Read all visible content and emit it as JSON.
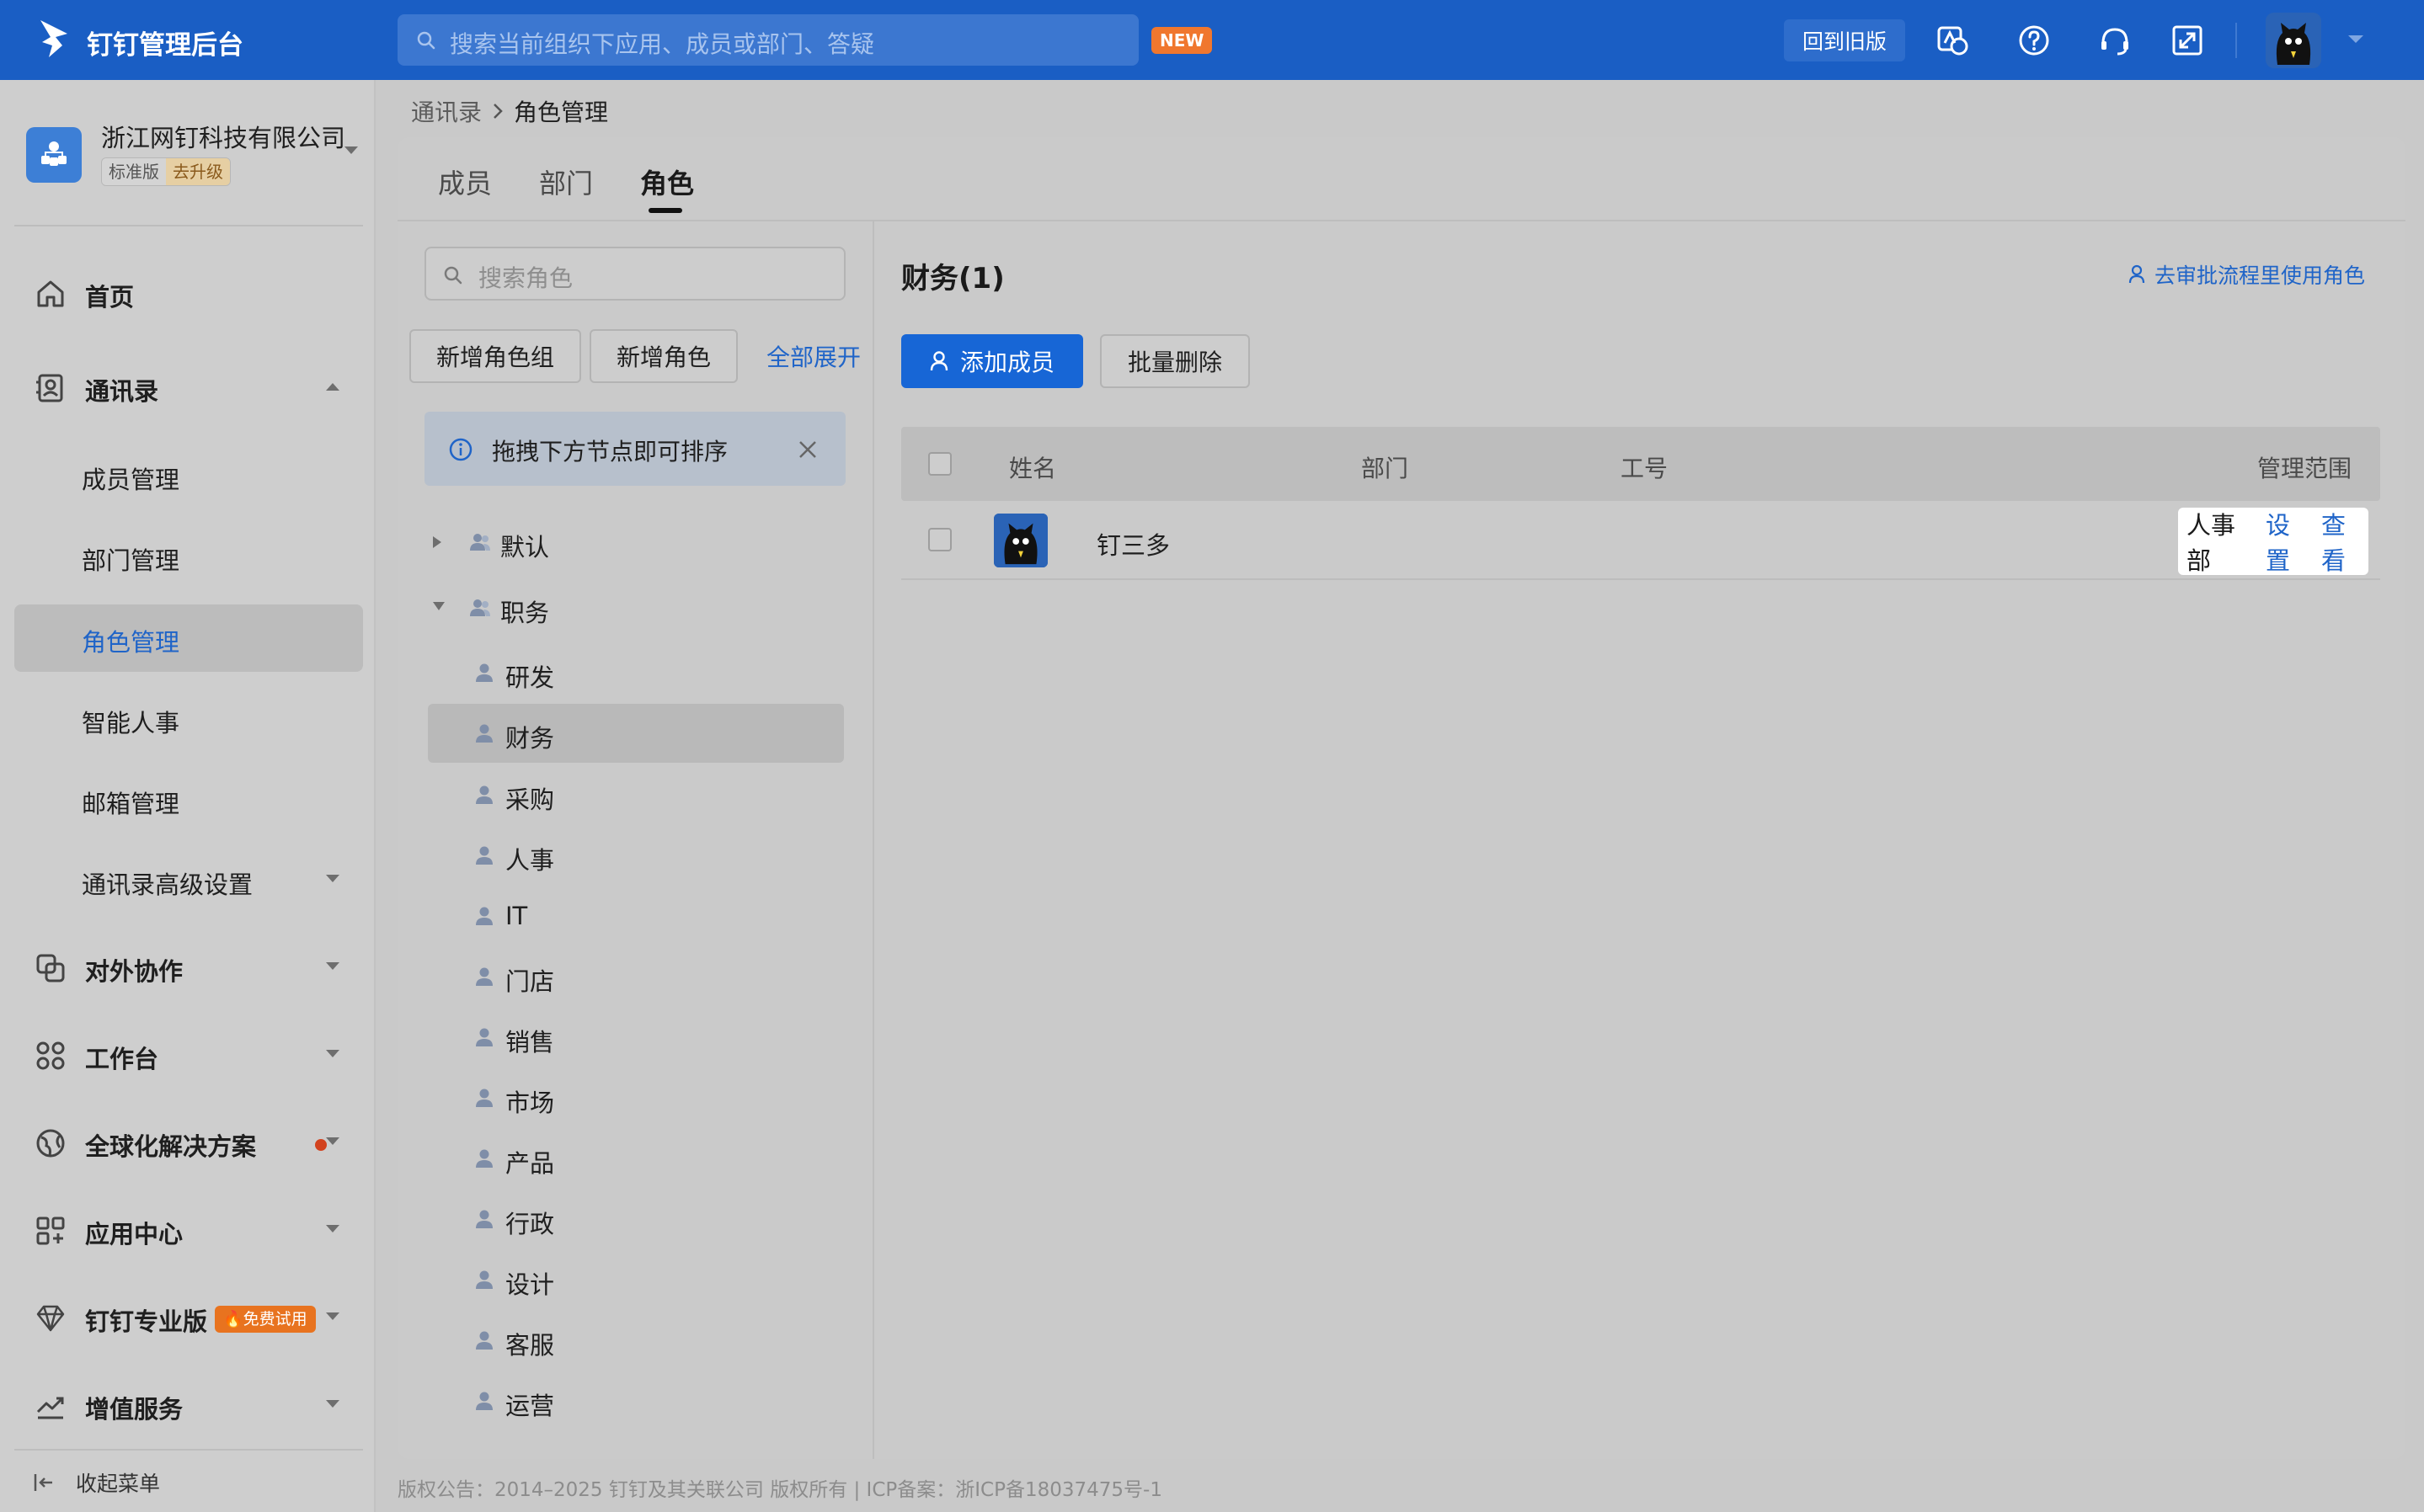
{
  "app": {
    "title": "钉钉管理后台"
  },
  "topbar": {
    "search_placeholder": "搜索当前组织下应用、成员或部门、答疑",
    "new_badge": "NEW",
    "old_version_button": "回到旧版",
    "icons": [
      "translate-icon",
      "help-icon",
      "support-headset-icon",
      "fullscreen-icon",
      "user-avatar"
    ]
  },
  "org": {
    "name": "浙江网钉科技有限公司",
    "edition": "标准版",
    "upgrade": "去升级"
  },
  "sidebar": {
    "home": "首页",
    "contacts": "通讯录",
    "contacts_sub": [
      "成员管理",
      "部门管理",
      "角色管理",
      "智能人事",
      "邮箱管理",
      "通讯录高级设置"
    ],
    "external": "对外协作",
    "workbench": "工作台",
    "global": "全球化解决方案",
    "app_center": "应用中心",
    "pro": "钉钉专业版",
    "pro_badge": "🔥免费试用",
    "value_added": "增值服务",
    "collapse": "收起菜单",
    "active_item": "角色管理"
  },
  "breadcrumb": {
    "parent": "通讯录",
    "current": "角色管理"
  },
  "tabs": [
    {
      "label": "成员",
      "active": false
    },
    {
      "label": "部门",
      "active": false
    },
    {
      "label": "角色",
      "active": true
    }
  ],
  "roles_pane": {
    "search_placeholder": "搜索角色",
    "add_group_button": "新增角色组",
    "add_role_button": "新增角色",
    "expand_all": "全部展开",
    "tip": "拖拽下方节点即可排序",
    "groups": [
      {
        "name": "默认",
        "expanded": false,
        "roles": []
      },
      {
        "name": "职务",
        "expanded": true,
        "roles": [
          "研发",
          "财务",
          "采购",
          "人事",
          "IT",
          "门店",
          "销售",
          "市场",
          "产品",
          "行政",
          "设计",
          "客服",
          "运营"
        ]
      }
    ],
    "selected_role": "财务"
  },
  "detail": {
    "title": "财务(1)",
    "approval_link": "去审批流程里使用角色",
    "add_member_button": "添加成员",
    "batch_delete_button": "批量删除",
    "columns": [
      "姓名",
      "部门",
      "工号",
      "管理范围"
    ],
    "rows": [
      {
        "name": "钉三多",
        "department": "",
        "employee_id": "",
        "scope": "人事部",
        "action_set": "设置",
        "action_view": "查看"
      }
    ]
  },
  "footer": "版权公告：2014–2025 钉钉及其关联公司 版权所有 | ICP备案：浙ICP备18037475号-1",
  "colors": {
    "topbar": "#1a5ec4",
    "accent": "#1f64c8",
    "primary_button": "#1766d6",
    "badge": "#f0772e"
  }
}
